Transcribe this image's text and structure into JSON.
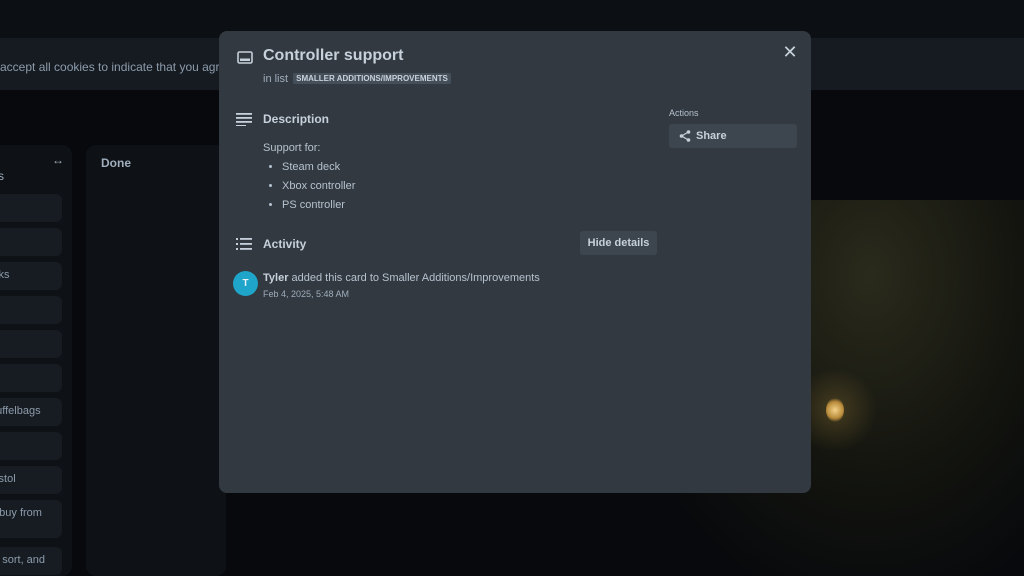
{
  "background": {
    "cookie_text": "accept all cookies to indicate that you agree to",
    "list": {
      "menu_glyph": "↔",
      "title": "s",
      "cards": [
        "",
        "",
        "inks",
        "",
        "",
        "",
        "duffelbags",
        "",
        "pistol",
        "o buy from",
        "n, sort, and"
      ]
    },
    "done_list_title": "Done"
  },
  "modal": {
    "title": "Controller support",
    "in_list_prefix": "in list",
    "list_name": "SMALLER ADDITIONS/IMPROVEMENTS",
    "description": {
      "heading": "Description",
      "intro": "Support for:",
      "items": [
        "Steam deck",
        "Xbox controller",
        "PS controller"
      ]
    },
    "activity": {
      "heading": "Activity",
      "hide_details_label": "Hide details",
      "entries": [
        {
          "avatar_initial": "T",
          "user": "Tyler",
          "action": " added this card to Smaller Additions/Improvements",
          "time": "Feb 4, 2025, 5:48 AM"
        }
      ]
    },
    "actions": {
      "label": "Actions",
      "share_label": "Share"
    },
    "close_glyph": "✕"
  },
  "colors": {
    "modal_bg": "#323940",
    "avatar": "#1fa5c9",
    "button_bg": "#3d454e"
  }
}
